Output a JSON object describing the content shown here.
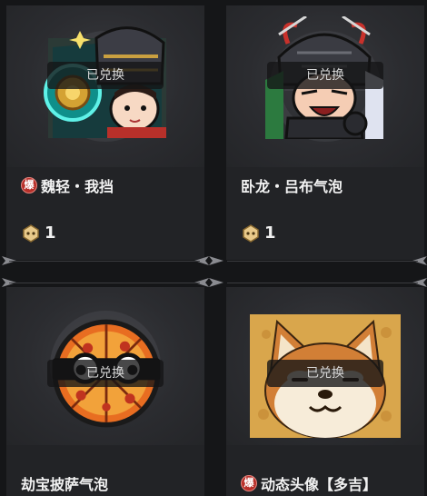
{
  "redeemed_label": "已兑换",
  "cards": [
    {
      "title": "魏轻・我挡",
      "burst_badge": "爆",
      "price": "1",
      "avatar": "armored-warrior-avatar"
    },
    {
      "title": "卧龙・吕布气泡",
      "price": "1",
      "avatar": "lu-bu-helmet-avatar"
    },
    {
      "title": "劫宝披萨气泡",
      "avatar": "pizza-glasses-avatar"
    },
    {
      "title": "动态头像【多吉】",
      "burst_badge": "爆",
      "avatar": "shiba-doge-avatar"
    }
  ],
  "colors": {
    "background": "#151618",
    "card": "#2a2b2e",
    "badge": "#b8302a",
    "coin": "#e8c98a"
  }
}
